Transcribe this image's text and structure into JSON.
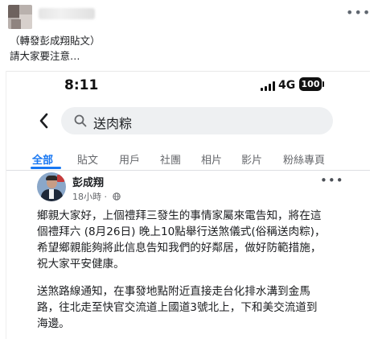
{
  "outer_post": {
    "share_note": "（轉發彭成翔貼文）",
    "caption": "請大家要注意…",
    "more_icon": "more-horizontal-dots"
  },
  "status_bar": {
    "time": "8:11",
    "network": "4G",
    "battery": "100"
  },
  "search": {
    "query": "送肉粽",
    "back_icon": "chevron-left",
    "search_icon": "magnifier"
  },
  "tabs": [
    {
      "label": "全部",
      "active": true
    },
    {
      "label": "貼文",
      "active": false
    },
    {
      "label": "用戶",
      "active": false
    },
    {
      "label": "社團",
      "active": false
    },
    {
      "label": "相片",
      "active": false
    },
    {
      "label": "影片",
      "active": false
    },
    {
      "label": "粉絲專頁",
      "active": false
    }
  ],
  "post": {
    "author": "彭成翔",
    "time_ago": "18小時",
    "separator": "·",
    "privacy_icon": "globe",
    "paragraph1": [
      "鄉親大家好，上個禮拜三發生的事情家屬來電告知，將在這",
      "個禮拜六 (8月26日) 晚上10點舉行送煞儀式(俗稱送肉粽)，",
      "希望鄉親能夠將此信息告知我們的好鄰居，做好防範措施，",
      "祝大家平安健康。"
    ],
    "paragraph2": [
      "送煞路線通知，在事發地點附近直接走台化排水溝到金馬",
      "路，往北走至快官交流道上國道3號北上，下和美交流道到",
      "海邊。"
    ]
  },
  "colors": {
    "accent": "#1877f2",
    "muted_text": "#65676b",
    "search_bg": "#eef0f2"
  }
}
